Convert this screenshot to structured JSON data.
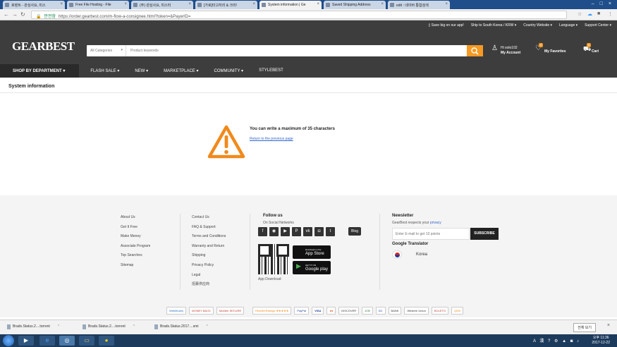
{
  "browser": {
    "tabs": [
      {
        "label": "호텐트 - 관심사요, 미스"
      },
      {
        "label": "Free File Hosting - File"
      },
      {
        "label": "(주) 관심사요, 미스터"
      },
      {
        "label": "[가로]타고저리 & 크리!"
      },
      {
        "label": "System information | Ge"
      },
      {
        "label": "Saved Shipping Address"
      },
      {
        "label": "edit : 네이버 통합검색"
      }
    ],
    "url_secure": "안전함",
    "url": "https://order.gearbest.com/m-flow-a-consignee.html?token=&PayerID="
  },
  "site": {
    "toplinks": [
      "Save big on our app!",
      "Ship to South Korea / KRW",
      "Country Website",
      "Language",
      "Support Center"
    ],
    "logo": "GEARBEST",
    "search": {
      "category": "All Categories",
      "placeholder": "Product keywords"
    },
    "account": {
      "greeting": "Hi solo102",
      "label": "My Account"
    },
    "favorites": {
      "label": "My Favorites",
      "count": "0"
    },
    "cart": {
      "label": "Cart",
      "count": "0"
    },
    "nav": [
      "SHOP BY DEPARTMENT",
      "FLASH SALE",
      "NEW",
      "MARKETPLACE",
      "COMMUNITY",
      "STYLEBEST"
    ]
  },
  "page": {
    "title": "System information",
    "message": "You can write a maximum of 35 characters",
    "return_link": "Return to the previous page"
  },
  "footer": {
    "col1": [
      "About Us",
      "Get It Free",
      "Make Money",
      "Associate Program",
      "Top Searches",
      "Sitemap"
    ],
    "col2": [
      "Contact Us",
      "FAQ & Support",
      "Terms and Conditions",
      "Warranty and Return",
      "Shipping",
      "Privacy Policy",
      "Legal",
      "招募供应商"
    ],
    "follow_title": "Follow us",
    "follow_sub": "On Social Networks",
    "socials": [
      "f",
      "◉",
      "▶",
      "P",
      "vk",
      "◘",
      "t"
    ],
    "blog": "Blog",
    "app_store": {
      "small": "Download on the",
      "label": "App Store"
    },
    "google_play": {
      "small": "GET IT ON",
      "label": "Google play"
    },
    "app_download": "App Download",
    "newsletter_title": "Newsletter",
    "newsletter_sub": "GearBest respects your",
    "newsletter_privacy": "privacy",
    "email_placeholder": "Enter E-mail to get 10 points",
    "subscribe": "SUBSCRIBE",
    "translator_title": "Google Translator",
    "translator_lang": "Korea",
    "payments": [
      "WebMoney",
      "MONEY BACK",
      "McAfee SECURE",
      "ResellerRatings ★★★★★",
      "PayPal",
      "VISA",
      "●●",
      "DISCOVER",
      "JCB",
      "DC",
      "BANK",
      "Western Union",
      "BOLETO",
      "QIWI"
    ]
  },
  "downloads": {
    "items": [
      "Brads.Status.2....torrent",
      "Brads.Status.2....torrent",
      "Brads.Status.2017....smi"
    ],
    "show_all": "전체 보기"
  },
  "taskbar": {
    "tray": "A 漢 ? ⚙ ▲ ◙ ♪",
    "clock_time": "오후 11:36",
    "clock_date": "2017-12-22"
  }
}
